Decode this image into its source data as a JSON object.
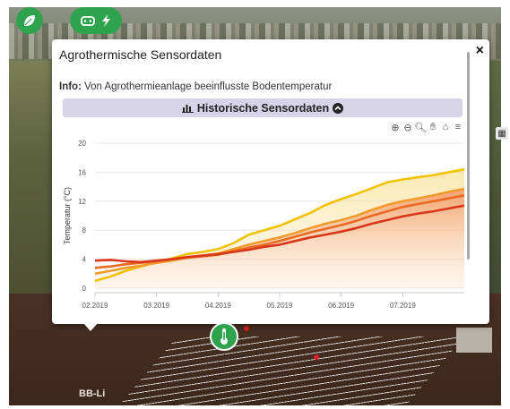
{
  "popup": {
    "title": "Agrothermische Sensordaten",
    "info_label": "Info:",
    "info_text": "Von Agrothermieanlage beeinflusste Bodentemperatur",
    "history_button": "Historische Sensordaten",
    "close": "×"
  },
  "map": {
    "label": "BB-Li"
  },
  "colors": {
    "green": "#2fa24e",
    "history_bar": "#d7d4ea",
    "series_yellow": "#f2c100",
    "series_orange": "#f39a2c",
    "series_red_orange": "#ea6a22",
    "series_red": "#d9361a"
  },
  "icons": {
    "leaf": "leaf-icon",
    "plug": "plug-icon",
    "lightning": "lightning-icon",
    "close": "close-icon",
    "chart_bars": "bar-chart-icon",
    "chevron_up": "chevron-up-circle-icon",
    "zoom_in": "zoom-in-icon",
    "zoom_out": "zoom-out-icon",
    "magnify": "magnifier-icon",
    "pan": "hand-icon",
    "home": "home-icon",
    "menu": "menu-icon",
    "thermometer": "thermometer-icon",
    "layers": "grid-icon"
  },
  "chart_data": {
    "type": "area",
    "ylabel": "Temperatur (°C)",
    "xlabel": "",
    "ylim": [
      0,
      20
    ],
    "yticks": [
      0,
      4,
      8,
      12,
      16,
      20
    ],
    "xticks": [
      "02.2019",
      "03.2019",
      "04.2019",
      "05.2019",
      "06.2019",
      "07.2019"
    ],
    "x": [
      0,
      0.25,
      0.5,
      0.75,
      1,
      1.25,
      1.5,
      1.75,
      2,
      2.25,
      2.5,
      2.75,
      3,
      3.25,
      3.5,
      3.75,
      4,
      4.25,
      4.5,
      4.75,
      5,
      5.25,
      5.5,
      5.75,
      6
    ],
    "series": [
      {
        "values": [
          1.0,
          1.6,
          2.4,
          3.0,
          3.6,
          4.1,
          4.7,
          5.0,
          5.4,
          6.2,
          7.4,
          8.0,
          8.6,
          9.5,
          10.4,
          11.5,
          12.3,
          13.0,
          13.8,
          14.6,
          15.0,
          15.3,
          15.6,
          16.0,
          16.4
        ]
      },
      {
        "values": [
          2.0,
          2.4,
          2.8,
          3.1,
          3.5,
          3.8,
          4.2,
          4.5,
          4.8,
          5.4,
          6.0,
          6.5,
          7.0,
          7.6,
          8.3,
          8.9,
          9.4,
          10.0,
          10.8,
          11.5,
          12.0,
          12.4,
          12.8,
          13.3,
          13.7
        ]
      },
      {
        "values": [
          2.8,
          3.0,
          3.3,
          3.5,
          3.7,
          4.0,
          4.2,
          4.4,
          4.6,
          5.1,
          5.6,
          6.0,
          6.5,
          7.1,
          7.7,
          8.2,
          8.7,
          9.3,
          10.0,
          10.6,
          11.2,
          11.6,
          12.0,
          12.4,
          12.8
        ]
      },
      {
        "values": [
          3.8,
          3.9,
          3.7,
          3.6,
          3.8,
          4.0,
          4.3,
          4.5,
          4.7,
          5.0,
          5.3,
          5.7,
          6.0,
          6.5,
          7.0,
          7.4,
          7.8,
          8.3,
          8.9,
          9.4,
          9.9,
          10.3,
          10.6,
          11.0,
          11.4
        ]
      }
    ]
  }
}
